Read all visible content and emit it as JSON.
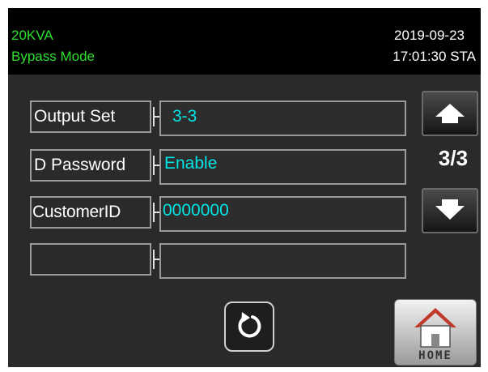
{
  "header": {
    "model": "20KVA",
    "mode": "Bypass Mode",
    "date": "2019-09-23",
    "time_status": "17:01:30 STA"
  },
  "settings": [
    {
      "label": "Output Set",
      "value": "3-3"
    },
    {
      "label": "D Password",
      "value": "Enable"
    },
    {
      "label": "CustomerID",
      "value": "0000000"
    },
    {
      "label": "",
      "value": ""
    }
  ],
  "pager": {
    "indicator": "3/3",
    "up_icon": "arrow-up-icon",
    "down_icon": "arrow-down-icon"
  },
  "footer": {
    "refresh_icon": "refresh-icon",
    "home_label": "HOME",
    "home_icon": "home-icon"
  },
  "colors": {
    "header_green": "#2ee02e",
    "value_cyan": "#00e5e5",
    "panel_bg": "#2a2a2a"
  }
}
